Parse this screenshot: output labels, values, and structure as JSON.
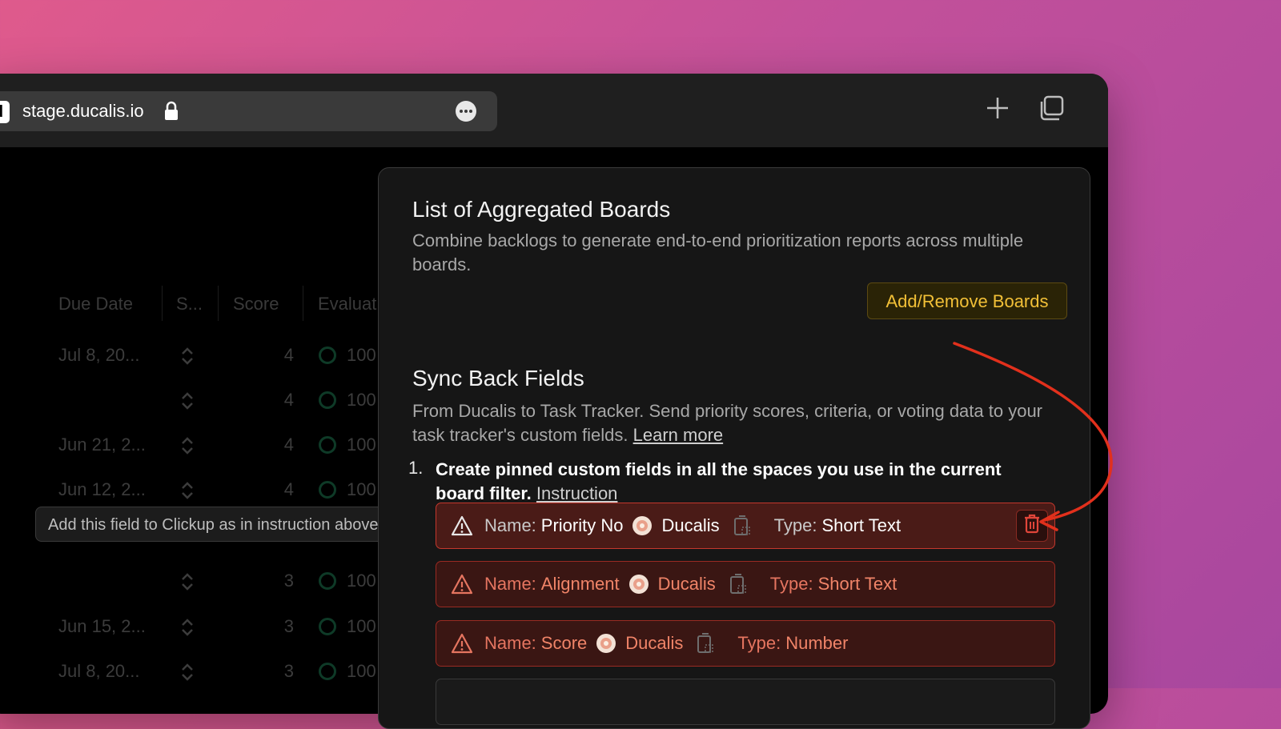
{
  "browser": {
    "favicon_letter": "d",
    "url": "stage.ducalis.io"
  },
  "table": {
    "headers": [
      "Due Date",
      "S...",
      "Score",
      "Evaluat"
    ],
    "rows": [
      {
        "date": "Jul 8, 20...",
        "score": "4",
        "eval": "100"
      },
      {
        "date": "",
        "score": "4",
        "eval": "100"
      },
      {
        "date": "Jun 21, 2...",
        "score": "4",
        "eval": "100"
      },
      {
        "date": "Jun 12, 2...",
        "score": "4",
        "eval": "100"
      },
      {
        "date": "",
        "score": "3",
        "eval": "100"
      },
      {
        "date": "Jun 15, 2...",
        "score": "3",
        "eval": "100"
      },
      {
        "date": "Jul 8, 20...",
        "score": "3",
        "eval": "100"
      }
    ]
  },
  "tooltip": "Add this field to Clickup as in instruction above",
  "panel": {
    "section1_title": "List of Aggregated Boards",
    "section1_desc": "Combine backlogs to generate end-to-end prioritization reports across multiple boards.",
    "add_remove_label": "Add/Remove Boards",
    "section2_title": "Sync Back Fields",
    "section2_desc": "From Ducalis to Task Tracker. Send priority scores, criteria, or voting data to your task tracker's custom fields.",
    "learn_more": "Learn more",
    "step_number": "1.",
    "step_text": "Create pinned custom fields in all the spaces you use in the current board filter.",
    "instruction_link": "Instruction",
    "fields": [
      {
        "name_label": "Name:",
        "name": "Priority No",
        "brand": "Ducalis",
        "type_label": "Type:",
        "type": "Short Text"
      },
      {
        "name_label": "Name:",
        "name": "Alignment",
        "brand": "Ducalis",
        "type_label": "Type:",
        "type": "Short Text"
      },
      {
        "name_label": "Name:",
        "name": "Score",
        "brand": "Ducalis",
        "type_label": "Type:",
        "type": "Number"
      }
    ]
  },
  "colors": {
    "accent_yellow": "#f2c037",
    "error_red": "#c4382d",
    "annotation_arrow": "#e2301c"
  }
}
